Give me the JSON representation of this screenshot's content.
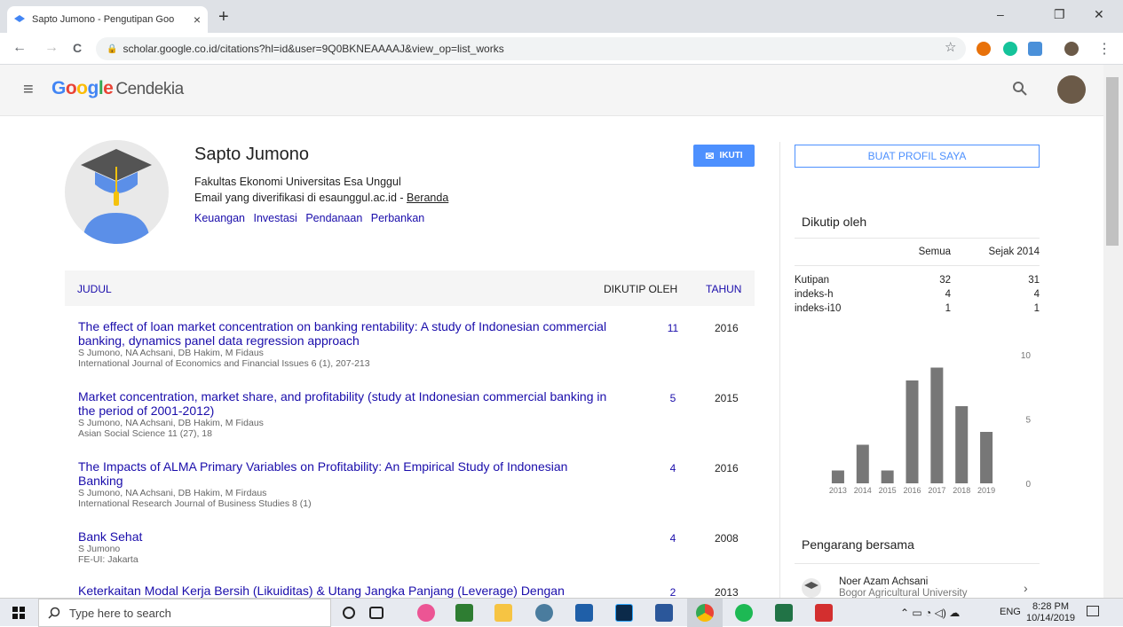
{
  "browser": {
    "tab_title": "Sapto Jumono - Pengutipan Goo",
    "tab_close": "×",
    "new_tab": "+",
    "url": "scholar.google.co.id/citations?hl=id&user=9Q0BKNEAAAAJ&view_op=list_works",
    "min": "–",
    "max": "❐",
    "close": "✕",
    "back": "←",
    "forward": "→",
    "reload": "C",
    "star": "☆",
    "menu": "⋮"
  },
  "app": {
    "logo": "Google",
    "product": "Cendekia",
    "menu_icon": "≡",
    "search_icon": "⚲"
  },
  "profile": {
    "name": "Sapto Jumono",
    "affiliation": "Fakultas Ekonomi Universitas Esa Unggul",
    "email_text": "Email yang diverifikasi di esaunggul.ac.id - ",
    "homepage": "Beranda",
    "interests": [
      "Keuangan",
      "Investasi",
      "Pendanaan",
      "Perbankan"
    ],
    "follow_label": "IKUTI"
  },
  "table": {
    "col_title": "JUDUL",
    "col_cited": "DIKUTIP OLEH",
    "col_year": "TAHUN",
    "rows": [
      {
        "title": "The effect of loan market concentration on banking rentability: A study of Indonesian commercial banking, dynamics panel data regression approach",
        "authors": "S Jumono, NA Achsani, DB Hakim, M Fidaus",
        "venue": "International Journal of Economics and Financial Issues 6 (1), 207-213",
        "cited": "11",
        "year": "2016"
      },
      {
        "title": "Market concentration, market share, and profitability (study at Indonesian commercial banking in the period of 2001-2012)",
        "authors": "S Jumono, NA Achsani, DB Hakim, M Fidaus",
        "venue": "Asian Social Science 11 (27), 18",
        "cited": "5",
        "year": "2015"
      },
      {
        "title": "The Impacts of ALMA Primary Variables on Profitability: An Empirical Study of Indonesian Banking",
        "authors": "S Jumono, NA Achsani, DB Hakim, M Firdaus",
        "venue": "International Research Journal of Business Studies 8 (1)",
        "cited": "4",
        "year": "2016"
      },
      {
        "title": "Bank Sehat",
        "authors": "S Jumono",
        "venue": "FE-UI: Jakarta",
        "cited": "4",
        "year": "2008"
      },
      {
        "title": "Keterkaitan Modal Kerja Bersih (Likuiditas) & Utang Jangka Panjang (Leverage) Dengan",
        "authors": "",
        "venue": "",
        "cited": "2",
        "year": "2013"
      }
    ]
  },
  "sidebar": {
    "make_profile": "BUAT PROFIL SAYA",
    "cited_by": "Dikutip oleh",
    "hdr_all": "Semua",
    "hdr_since": "Sejak 2014",
    "stats": [
      {
        "label": "Kutipan",
        "all": "32",
        "since": "31"
      },
      {
        "label": "indeks-h",
        "all": "4",
        "since": "4"
      },
      {
        "label": "indeks-i10",
        "all": "1",
        "since": "1"
      }
    ],
    "coauthors_title": "Pengarang bersama",
    "coauthor": {
      "name": "Noer Azam Achsani",
      "affil": "Bogor Agricultural University"
    }
  },
  "chart_data": {
    "type": "bar",
    "categories": [
      "2013",
      "2014",
      "2015",
      "2016",
      "2017",
      "2018",
      "2019"
    ],
    "values": [
      1,
      3,
      1,
      8,
      9,
      6,
      4
    ],
    "ylim": [
      0,
      10
    ],
    "yticks": [
      "10",
      "5",
      "0"
    ],
    "bar_color": "#777777"
  },
  "taskbar": {
    "search_placeholder": "Type here to search",
    "lang": "ENG",
    "time": "8:28 PM",
    "date": "10/14/2019"
  }
}
